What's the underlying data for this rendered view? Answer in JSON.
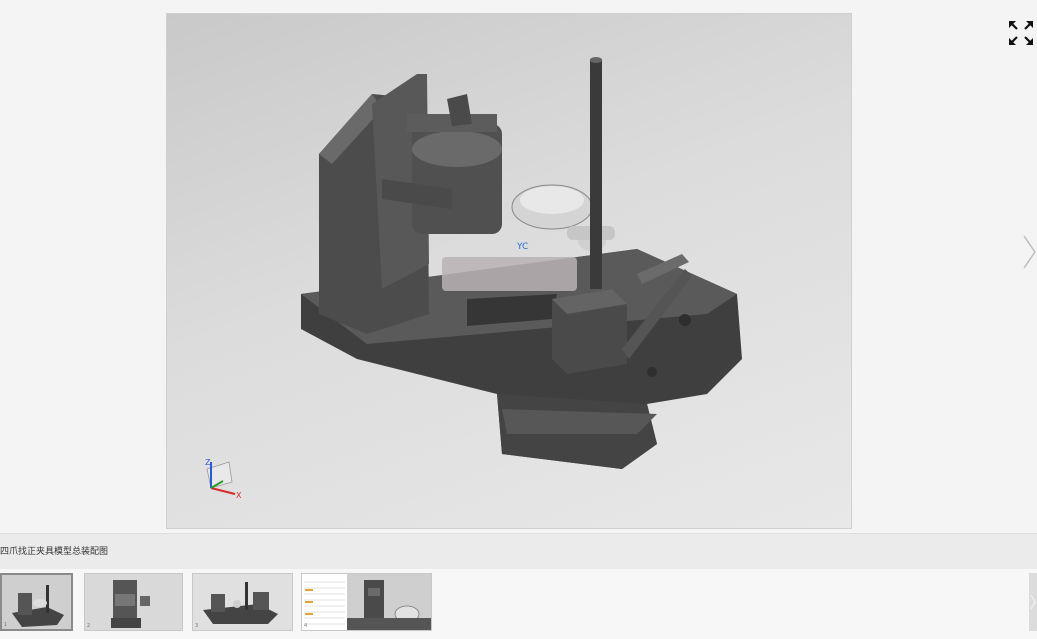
{
  "viewer": {
    "fullscreen_icon": "expand-arrows-icon",
    "next_icon": "chevron-right-icon",
    "axis_triad": {
      "z_label": "Z",
      "x_label": "X"
    },
    "yc_label": "YC"
  },
  "caption": {
    "text": "四爪找正夹具模型总装配图"
  },
  "thumbnails": {
    "items": [
      {
        "index_label": "1",
        "active": true
      },
      {
        "index_label": "2",
        "active": false
      },
      {
        "index_label": "3",
        "active": false
      },
      {
        "index_label": "4",
        "active": false
      }
    ],
    "next_icon": "chevron-right-icon"
  },
  "colors": {
    "part_dark": "#4a4a4a",
    "part_mid": "#5c5c5c",
    "part_light": "#cfcfcf",
    "strip_bg": "#f7f7f7"
  }
}
